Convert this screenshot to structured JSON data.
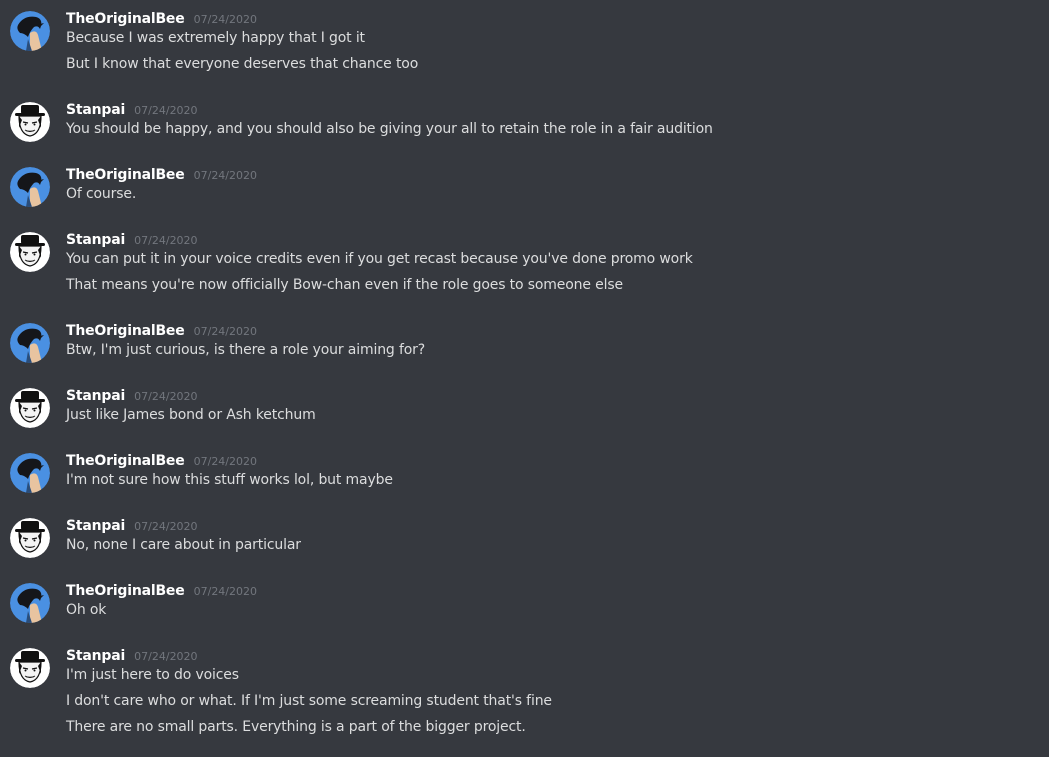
{
  "messages": [
    {
      "author": "TheOriginalBee",
      "avatar": "bee-avatar",
      "timestamp": "07/24/2020",
      "lines": [
        "Because I was extremely happy that I got it",
        "But I know that everyone deserves that chance too"
      ]
    },
    {
      "author": "Stanpai",
      "avatar": "stanpai-avatar",
      "timestamp": "07/24/2020",
      "lines": [
        "You should be happy, and you should also be giving your all to retain the role in a fair audition"
      ]
    },
    {
      "author": "TheOriginalBee",
      "avatar": "bee-avatar",
      "timestamp": "07/24/2020",
      "lines": [
        "Of course."
      ]
    },
    {
      "author": "Stanpai",
      "avatar": "stanpai-avatar",
      "timestamp": "07/24/2020",
      "lines": [
        "You can put it in your voice credits even if you get recast because you've done promo work",
        "That means you're now officially Bow-chan even if the role goes to someone else"
      ]
    },
    {
      "author": "TheOriginalBee",
      "avatar": "bee-avatar",
      "timestamp": "07/24/2020",
      "lines": [
        "Btw, I'm just curious, is there a role your aiming for?"
      ]
    },
    {
      "author": "Stanpai",
      "avatar": "stanpai-avatar",
      "timestamp": "07/24/2020",
      "lines": [
        "Just like James bond or Ash ketchum"
      ]
    },
    {
      "author": "TheOriginalBee",
      "avatar": "bee-avatar",
      "timestamp": "07/24/2020",
      "lines": [
        "I'm not sure how this stuff works lol, but maybe"
      ]
    },
    {
      "author": "Stanpai",
      "avatar": "stanpai-avatar",
      "timestamp": "07/24/2020",
      "lines": [
        "No, none I care about in particular"
      ]
    },
    {
      "author": "TheOriginalBee",
      "avatar": "bee-avatar",
      "timestamp": "07/24/2020",
      "lines": [
        "Oh ok"
      ]
    },
    {
      "author": "Stanpai",
      "avatar": "stanpai-avatar",
      "timestamp": "07/24/2020",
      "lines": [
        "I'm just here to do voices",
        "I don't care who or what. If I'm just some screaming student that's fine",
        "There are no small parts. Everything is a part of the bigger project."
      ]
    }
  ],
  "colors": {
    "background": "#36393f",
    "username": "#ffffff",
    "timestamp": "#72767d",
    "message_text": "#dcddde",
    "bee_avatar_bg": "#4a90e2",
    "stanpai_avatar_bg": "#ffffff"
  }
}
